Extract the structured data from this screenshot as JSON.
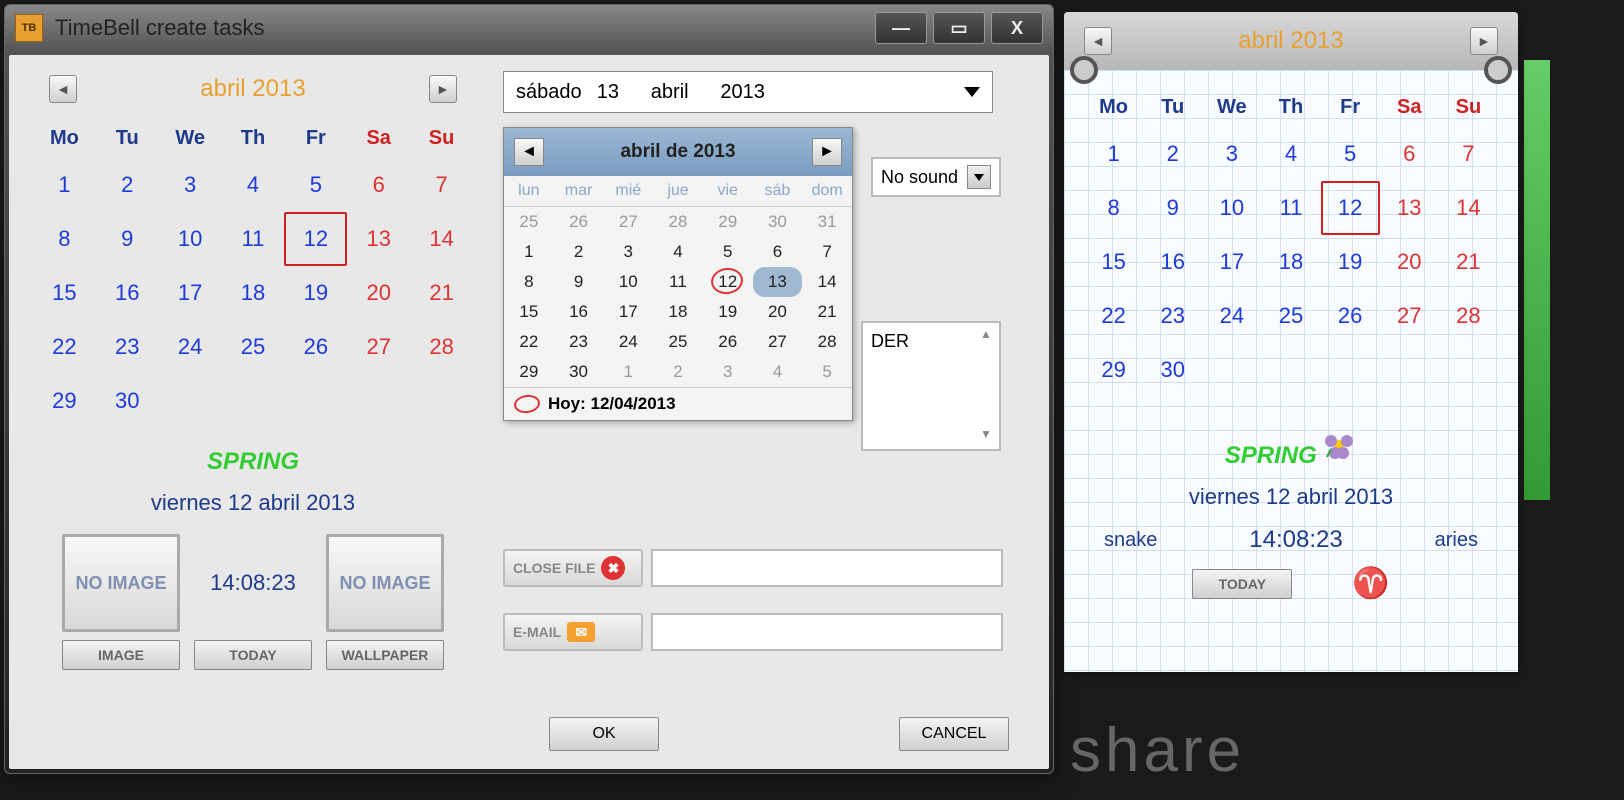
{
  "window": {
    "icon_text": "TB",
    "title": "TimeBell create tasks"
  },
  "calendar": {
    "title": "abril 2013",
    "headers": [
      "Mo",
      "Tu",
      "We",
      "Th",
      "Fr",
      "Sa",
      "Su"
    ],
    "weeks": [
      [
        1,
        2,
        3,
        4,
        5,
        6,
        7
      ],
      [
        8,
        9,
        10,
        11,
        12,
        13,
        14
      ],
      [
        15,
        16,
        17,
        18,
        19,
        20,
        21
      ],
      [
        22,
        23,
        24,
        25,
        26,
        27,
        28
      ],
      [
        29,
        30,
        null,
        null,
        null,
        null,
        null
      ]
    ],
    "today": 12,
    "season": "SPRING",
    "date_line": "viernes 12 abril 2013",
    "time": "14:08:23",
    "no_image_label": "NO IMAGE",
    "btn_image": "IMAGE",
    "btn_today": "TODAY",
    "btn_wallpaper": "WALLPAPER"
  },
  "date_combo": {
    "weekday": "sábado",
    "day": "13",
    "month": "abril",
    "year": "2013"
  },
  "popup": {
    "title": "abril de 2013",
    "headers": [
      "lun",
      "mar",
      "mié",
      "jue",
      "vie",
      "sáb",
      "dom"
    ],
    "grid": [
      {
        "d": 25,
        "out": true
      },
      {
        "d": 26,
        "out": true
      },
      {
        "d": 27,
        "out": true
      },
      {
        "d": 28,
        "out": true
      },
      {
        "d": 29,
        "out": true
      },
      {
        "d": 30,
        "out": true
      },
      {
        "d": 31,
        "out": true
      },
      {
        "d": 1
      },
      {
        "d": 2
      },
      {
        "d": 3
      },
      {
        "d": 4
      },
      {
        "d": 5
      },
      {
        "d": 6
      },
      {
        "d": 7
      },
      {
        "d": 8
      },
      {
        "d": 9
      },
      {
        "d": 10
      },
      {
        "d": 11
      },
      {
        "d": 12,
        "mark": true
      },
      {
        "d": 13,
        "sel": true
      },
      {
        "d": 14
      },
      {
        "d": 15
      },
      {
        "d": 16
      },
      {
        "d": 17
      },
      {
        "d": 18
      },
      {
        "d": 19
      },
      {
        "d": 20
      },
      {
        "d": 21
      },
      {
        "d": 22
      },
      {
        "d": 23
      },
      {
        "d": 24
      },
      {
        "d": 25
      },
      {
        "d": 26
      },
      {
        "d": 27
      },
      {
        "d": 28
      },
      {
        "d": 29
      },
      {
        "d": 30
      },
      {
        "d": 1,
        "out": true
      },
      {
        "d": 2,
        "out": true
      },
      {
        "d": 3,
        "out": true
      },
      {
        "d": 4,
        "out": true
      },
      {
        "d": 5,
        "out": true
      }
    ],
    "footer": "Hoy: 12/04/2013"
  },
  "sound_label": "No sound",
  "der_label": "DER",
  "close_file_label": "CLOSE FILE",
  "email_label": "E-MAIL",
  "ok_label": "OK",
  "cancel_label": "CANCEL",
  "widget": {
    "title": "abril 2013",
    "headers": [
      "Mo",
      "Tu",
      "We",
      "Th",
      "Fr",
      "Sa",
      "Su"
    ],
    "season": "SPRING",
    "date_line": "viernes 12 abril 2013",
    "animal": "snake",
    "time": "14:08:23",
    "zodiac": "aries",
    "zodiac_symbol": "♈",
    "today_btn": "TODAY"
  },
  "share_watermark": "share"
}
